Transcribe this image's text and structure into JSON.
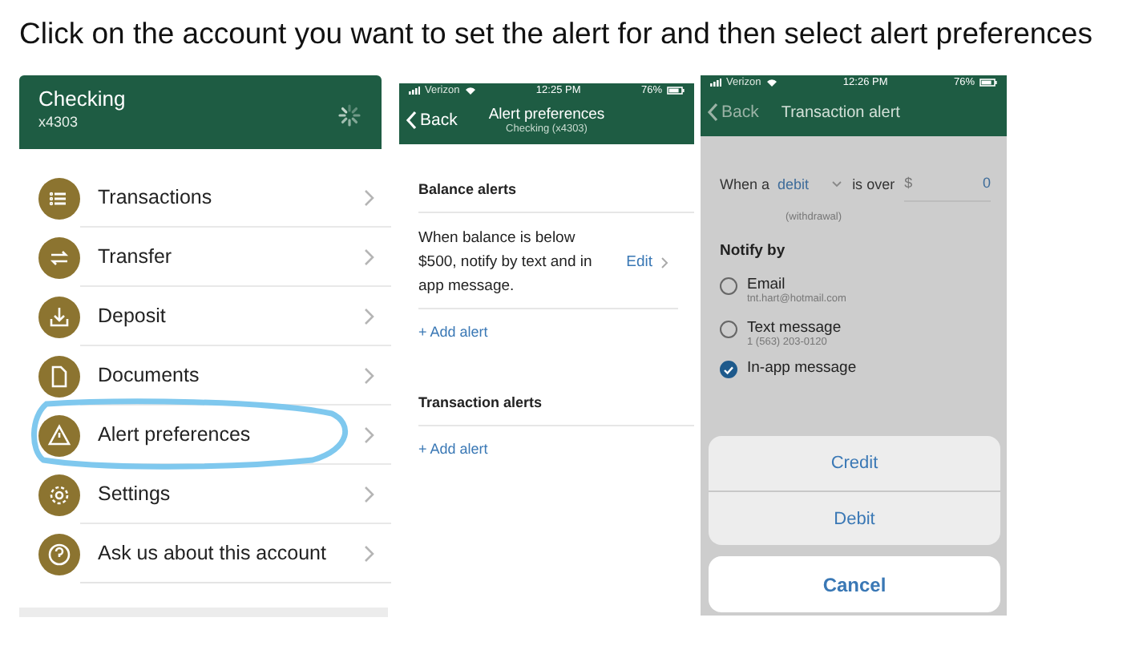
{
  "caption": "Click on the account you want to set the alert for and then select alert preferences",
  "account_menu": {
    "account_name": "Checking",
    "account_number": "x4303",
    "items": [
      {
        "label": "Transactions",
        "circled": false
      },
      {
        "label": "Transfer",
        "circled": false
      },
      {
        "label": "Deposit",
        "circled": false
      },
      {
        "label": "Documents",
        "circled": false
      },
      {
        "label": "Alert preferences",
        "circled": true
      },
      {
        "label": "Settings",
        "circled": false
      },
      {
        "label": "Ask us about this account",
        "circled": false
      }
    ]
  },
  "alert_preferences": {
    "status_bar": {
      "carrier": "Verizon",
      "time": "12:25 PM",
      "battery": "76%"
    },
    "back": "Back",
    "title": "Alert preferences",
    "subtitle": "Checking (x4303)",
    "sections": [
      {
        "heading": "Balance alerts",
        "alerts": [
          {
            "text": "When balance is below $500, notify by text and in app message.",
            "edit": "Edit"
          }
        ],
        "add": "+ Add alert"
      },
      {
        "heading": "Transaction alerts",
        "add": "+ Add alert"
      }
    ]
  },
  "transaction_alert": {
    "status_bar": {
      "carrier": "Verizon",
      "time": "12:26 PM",
      "battery": "76%"
    },
    "back": "Back",
    "title": "Transaction alert",
    "condition": {
      "prefix": "When a",
      "type": "debit",
      "type_hint": "(withdrawal)",
      "middle": "is over",
      "currency": "$",
      "amount": "0"
    },
    "notify_heading": "Notify by",
    "options": [
      {
        "label": "Email",
        "detail": "tnt.hart@hotmail.com",
        "selected": false
      },
      {
        "label": "Text message",
        "detail": "1 (563) 203-0120",
        "selected": false
      },
      {
        "label": "In-app message",
        "selected": true
      }
    ],
    "action_sheet": {
      "choices": [
        "Credit",
        "Debit"
      ],
      "cancel": "Cancel"
    }
  }
}
